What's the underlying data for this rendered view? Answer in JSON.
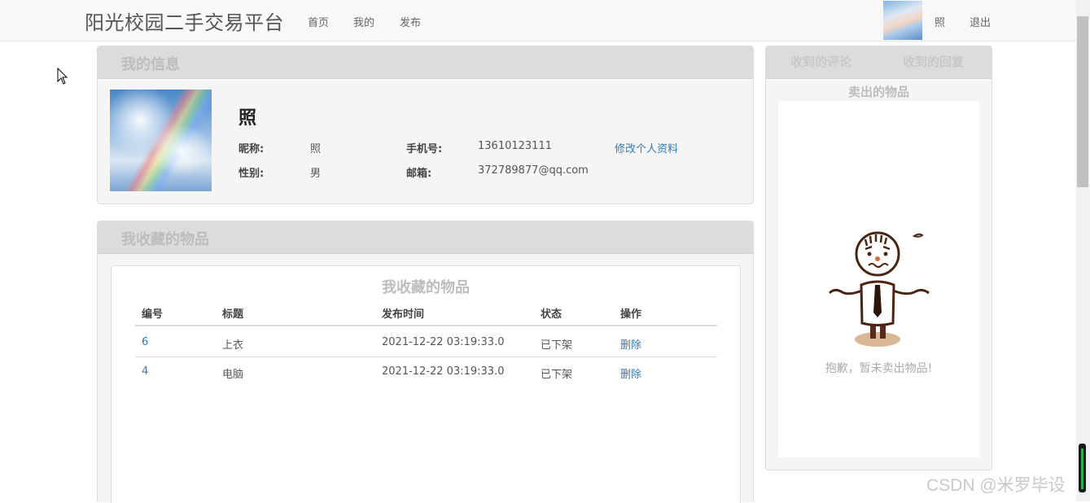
{
  "nav": {
    "brand": "阳光校园二手交易平台",
    "links": [
      "首页",
      "我的",
      "发布"
    ],
    "username": "照",
    "logout": "退出"
  },
  "profile": {
    "panel_title": "我的信息",
    "name": "照",
    "nickname_label": "昵称:",
    "nickname": "照",
    "gender_label": "性别:",
    "gender": "男",
    "phone_label": "手机号:",
    "phone": "13610123111",
    "email_label": "邮箱:",
    "email": "372789877@qq.com",
    "edit_link": "修改个人资料"
  },
  "favorites": {
    "panel_title": "我收藏的物品",
    "caption": "我收藏的物品",
    "columns": [
      "编号",
      "标题",
      "发布时间",
      "状态",
      "操作"
    ],
    "rows": [
      {
        "id": "6",
        "title": "上衣",
        "time": "2021-12-22 03:19:33.0",
        "status": "已下架",
        "action": "删除"
      },
      {
        "id": "4",
        "title": "电脑",
        "time": "2021-12-22 03:19:33.0",
        "status": "已下架",
        "action": "删除"
      }
    ]
  },
  "sidebar": {
    "tabs": [
      "收到的评论",
      "收到的回复"
    ],
    "sold_title": "卖出的物品",
    "empty_message": "抱歉，暂未卖出物品!"
  },
  "watermark": "CSDN @米罗毕设"
}
